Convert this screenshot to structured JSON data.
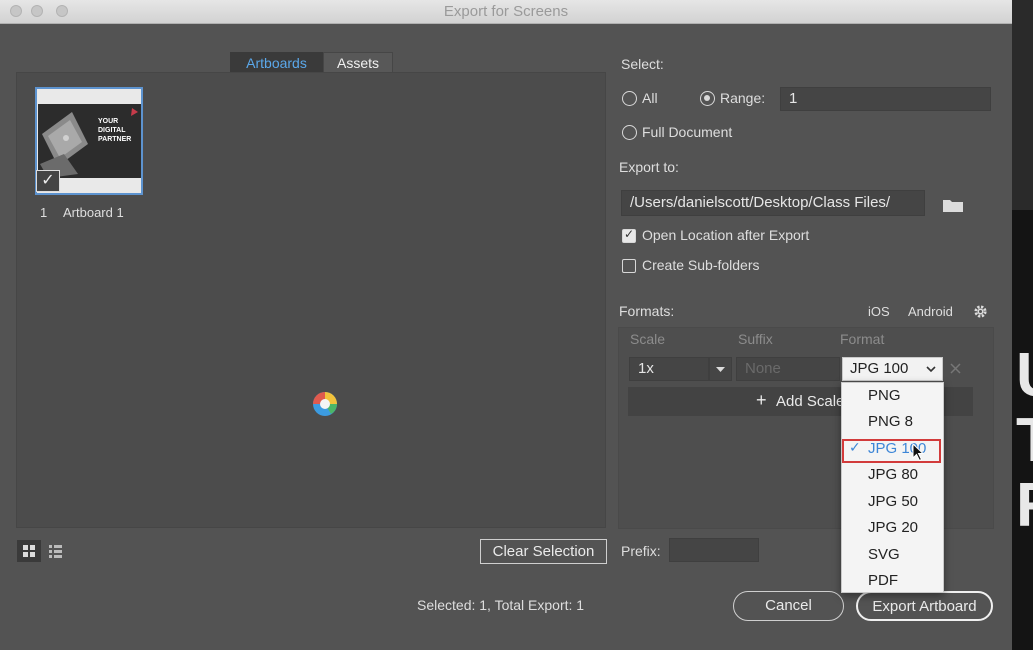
{
  "window": {
    "title": "Export for Screens"
  },
  "tabs": [
    {
      "label": "Artboards",
      "active": true
    },
    {
      "label": "Assets",
      "active": false
    }
  ],
  "artboard": {
    "number": "1",
    "name": "Artboard 1",
    "thumb_text": [
      "YOUR",
      "DIGITAL",
      "PARTNER"
    ]
  },
  "select": {
    "label": "Select:",
    "all_label": "All",
    "range_label": "Range:",
    "range_value": "1",
    "full_doc_label": "Full Document",
    "selected": "Range"
  },
  "export_to": {
    "label": "Export to:",
    "path": "/Users/danielscott/Desktop/Class Files/",
    "open_location_label": "Open Location after Export",
    "open_location_checked": true,
    "subfolders_label": "Create Sub-folders",
    "subfolders_checked": false
  },
  "formats": {
    "label": "Formats:",
    "ios_label": "iOS",
    "android_label": "Android",
    "columns": {
      "scale": "Scale",
      "suffix": "Suffix",
      "format": "Format"
    },
    "row": {
      "scale": "1x",
      "suffix_placeholder": "None",
      "format": "JPG 100"
    },
    "add_scale_label": "Add Scale",
    "dropdown_options": [
      "PNG",
      "PNG 8",
      "JPG 100",
      "JPG 80",
      "JPG 50",
      "JPG 20",
      "SVG",
      "PDF"
    ],
    "dropdown_selected": "JPG 100"
  },
  "footer": {
    "clear_selection": "Clear Selection",
    "prefix_label": "Prefix:",
    "prefix_value": "",
    "status": "Selected: 1, Total Export: 1",
    "cancel": "Cancel",
    "export": "Export Artboard"
  },
  "background_letters": [
    "U",
    "T",
    "R"
  ],
  "colors": {
    "accent": "#5ba8ea",
    "panel": "#535353",
    "highlight": "#d23b3b"
  }
}
